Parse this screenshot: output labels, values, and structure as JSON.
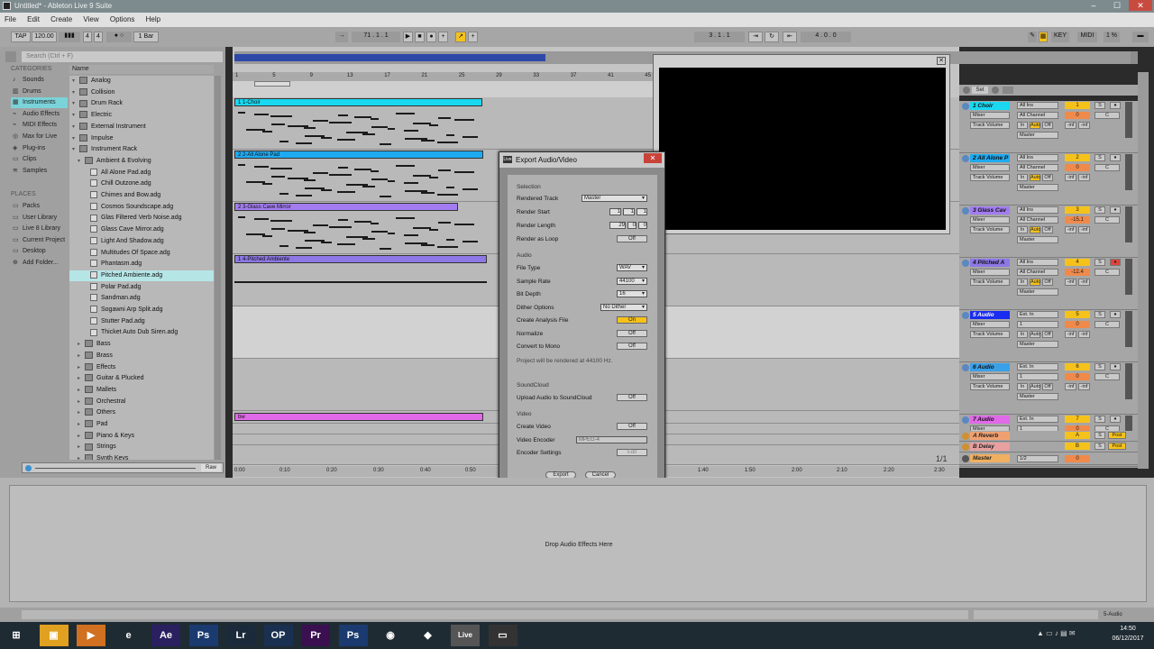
{
  "window": {
    "title": "Untitled* - Ableton Live 9 Suite",
    "minimize": "–",
    "maximize": "☐",
    "close": "✕"
  },
  "menu": [
    "File",
    "Edit",
    "Create",
    "View",
    "Options",
    "Help"
  ],
  "control_bar": {
    "tap": "TAP",
    "tempo": "120.00",
    "sig_num": "4",
    "sig_den": "4",
    "quantize": "1 Bar",
    "position": "71 . 1 . 1",
    "loop_start": "3 . 1 . 1",
    "loop_length": "4 . 0 . 0",
    "key": "KEY",
    "midi": "MIDI",
    "cpu": "1 %"
  },
  "browser": {
    "search_placeholder": "Search (Ctrl + F)",
    "categories_header": "CATEGORIES",
    "categories": [
      "Sounds",
      "Drums",
      "Instruments",
      "Audio Effects",
      "MIDI Effects",
      "Max for Live",
      "Plug-ins",
      "Clips",
      "Samples"
    ],
    "places_header": "PLACES",
    "places": [
      "Packs",
      "User Library",
      "Live 8 Library",
      "Current Project",
      "Desktop",
      "Add Folder..."
    ],
    "name_header": "Name",
    "items": [
      {
        "label": "Analog",
        "kind": "folder",
        "indent": 0
      },
      {
        "label": "Collision",
        "kind": "folder",
        "indent": 0
      },
      {
        "label": "Drum Rack",
        "kind": "folder",
        "indent": 0
      },
      {
        "label": "Electric",
        "kind": "folder",
        "indent": 0
      },
      {
        "label": "External Instrument",
        "kind": "folder",
        "indent": 0
      },
      {
        "label": "Impulse",
        "kind": "folder",
        "indent": 0
      },
      {
        "label": "Instrument Rack",
        "kind": "folder-open",
        "indent": 0
      },
      {
        "label": "Ambient & Evolving",
        "kind": "folder-open",
        "indent": 1
      },
      {
        "label": "All Alone Pad.adg",
        "kind": "file",
        "indent": 2
      },
      {
        "label": "Chill Outzone.adg",
        "kind": "file",
        "indent": 2
      },
      {
        "label": "Chimes and Bow.adg",
        "kind": "file",
        "indent": 2
      },
      {
        "label": "Cosmos Soundscape.adg",
        "kind": "file",
        "indent": 2
      },
      {
        "label": "Glas Filtered Verb Noise.adg",
        "kind": "file",
        "indent": 2
      },
      {
        "label": "Glass Cave Mirror.adg",
        "kind": "file",
        "indent": 2
      },
      {
        "label": "Light And Shadow.adg",
        "kind": "file",
        "indent": 2
      },
      {
        "label": "Multitudes Of Space.adg",
        "kind": "file",
        "indent": 2
      },
      {
        "label": "Phantasm.adg",
        "kind": "file",
        "indent": 2
      },
      {
        "label": "Pitched Ambiente.adg",
        "kind": "file",
        "indent": 2,
        "selected": true
      },
      {
        "label": "Polar Pad.adg",
        "kind": "file",
        "indent": 2
      },
      {
        "label": "Sandman.adg",
        "kind": "file",
        "indent": 2
      },
      {
        "label": "Sogawni Arp Split.adg",
        "kind": "file",
        "indent": 2
      },
      {
        "label": "Stutter Pad.adg",
        "kind": "file",
        "indent": 2
      },
      {
        "label": "Thicket Auto Dub Siren.adg",
        "kind": "file",
        "indent": 2
      },
      {
        "label": "Bass",
        "kind": "closed",
        "indent": 1
      },
      {
        "label": "Brass",
        "kind": "closed",
        "indent": 1
      },
      {
        "label": "Effects",
        "kind": "closed",
        "indent": 1
      },
      {
        "label": "Guitar & Plucked",
        "kind": "closed",
        "indent": 1
      },
      {
        "label": "Mallets",
        "kind": "closed",
        "indent": 1
      },
      {
        "label": "Orchestral",
        "kind": "closed",
        "indent": 1
      },
      {
        "label": "Others",
        "kind": "closed",
        "indent": 1
      },
      {
        "label": "Pad",
        "kind": "closed",
        "indent": 1
      },
      {
        "label": "Piano & Keys",
        "kind": "closed",
        "indent": 1
      },
      {
        "label": "Strings",
        "kind": "closed",
        "indent": 1
      },
      {
        "label": "Synth Keys",
        "kind": "closed",
        "indent": 1
      }
    ],
    "raw": "Raw"
  },
  "ruler_bars": [
    "1",
    "5",
    "9",
    "13",
    "17",
    "21",
    "25",
    "29",
    "33",
    "37",
    "41",
    "45"
  ],
  "time_ruler": [
    "0:00",
    "0:10",
    "0:20",
    "0:30",
    "0:40",
    "0:50",
    "1:40",
    "1:50",
    "2:00",
    "2:10",
    "2:20",
    "2:30"
  ],
  "clips": [
    {
      "label": "1 1-Choir",
      "color": "#19d8f0"
    },
    {
      "label": "2 2-All Alone Pad",
      "color": "#1eaaf0"
    },
    {
      "label": "2 3-Glass Cave Mirror",
      "color": "#a27cf0"
    },
    {
      "label": "1 4-Pitched Ambiente",
      "color": "#8d78e6"
    },
    {
      "label": "bw",
      "color": "#e06ae8"
    }
  ],
  "mixer": {
    "set": "Set",
    "page": "1/1",
    "tracks": [
      {
        "name": "1 Choir",
        "color": "#19d8f0",
        "input": "All Ins",
        "channel": "All Channel",
        "num": "1",
        "val": "0",
        "type": "midi"
      },
      {
        "name": "2 All Alone P",
        "color": "#1eaaf0",
        "input": "All Ins",
        "channel": "All Channel",
        "num": "2",
        "val": "0",
        "type": "midi"
      },
      {
        "name": "3 Glass Cav",
        "color": "#a27cf0",
        "input": "All Ins",
        "channel": "All Channel",
        "num": "3",
        "val": "-15.1",
        "type": "midi"
      },
      {
        "name": "4 Pitched A",
        "color": "#8d78e6",
        "input": "All Ins",
        "channel": "All Channel",
        "num": "4",
        "val": "-12.4",
        "type": "midi"
      },
      {
        "name": "5 Audio",
        "color": "#1a2cf0",
        "input": "Ext. In",
        "channel": "1",
        "num": "5",
        "val": "0",
        "type": "audio"
      },
      {
        "name": "6 Audio",
        "color": "#3aa0e8",
        "input": "Ext. In",
        "channel": "1",
        "num": "6",
        "val": "0",
        "type": "audio"
      },
      {
        "name": "7 Audio",
        "color": "#e06ae8",
        "input": "Ext. In",
        "channel": "1",
        "num": "7",
        "val": "0",
        "type": "audio"
      }
    ],
    "returns": [
      {
        "name": "A Reverb",
        "color": "#f0a070",
        "num": "A"
      },
      {
        "name": "B Delay",
        "color": "#e8a0a0",
        "num": "B"
      }
    ],
    "master": {
      "name": "Master",
      "routing": "1/2",
      "val": "0"
    },
    "labels": {
      "mixer": "Mixer",
      "track_volume": "Track Volume",
      "master": "Master",
      "in": "In",
      "auto": "Auto",
      "off": "Off",
      "inf": "-inf",
      "s": "S",
      "c": "C",
      "post": "Post"
    }
  },
  "export_dialog": {
    "title": "Export Audio/Video",
    "selection": "Selection",
    "rendered_track_label": "Rendered Track",
    "rendered_track": "Master",
    "render_start_label": "Render Start",
    "render_start": [
      "1",
      "1",
      "1"
    ],
    "render_length_label": "Render Length",
    "render_length": [
      "29",
      "0",
      "0"
    ],
    "render_loop_label": "Render as Loop",
    "render_loop": "Off",
    "audio": "Audio",
    "file_type_label": "File Type",
    "file_type": "WAV",
    "sample_rate_label": "Sample Rate",
    "sample_rate": "44100",
    "bit_depth_label": "Bit Depth",
    "bit_depth": "16",
    "dither_label": "Dither Options",
    "dither": "No Dither",
    "analysis_label": "Create Analysis File",
    "analysis": "On",
    "normalize_label": "Normalize",
    "normalize": "Off",
    "mono_label": "Convert to Mono",
    "mono": "Off",
    "project_note": "Project will be rendered at 44100 Hz.",
    "soundcloud": "SoundCloud",
    "upload_label": "Upload Audio to SoundCloud",
    "upload": "Off",
    "video": "Video",
    "create_video_label": "Create Video",
    "create_video": "Off",
    "video_encoder_label": "Video Encoder",
    "video_encoder": "MPEG-4",
    "encoder_settings_label": "Encoder Settings",
    "encoder_settings": "Edit",
    "export_btn": "Export",
    "cancel_btn": "Cancel"
  },
  "detail": {
    "drop_text": "Drop Audio Effects Here"
  },
  "status": {
    "right": "5-Audio"
  },
  "taskbar": {
    "apps": [
      "⊞",
      "▣",
      "▶",
      "e",
      "Ae",
      "Ps",
      "Lr",
      "OP",
      "Pr",
      "Ps",
      "◉",
      "◆",
      "Live",
      "▭"
    ],
    "time": "14:50",
    "date": "06/12/2017"
  }
}
